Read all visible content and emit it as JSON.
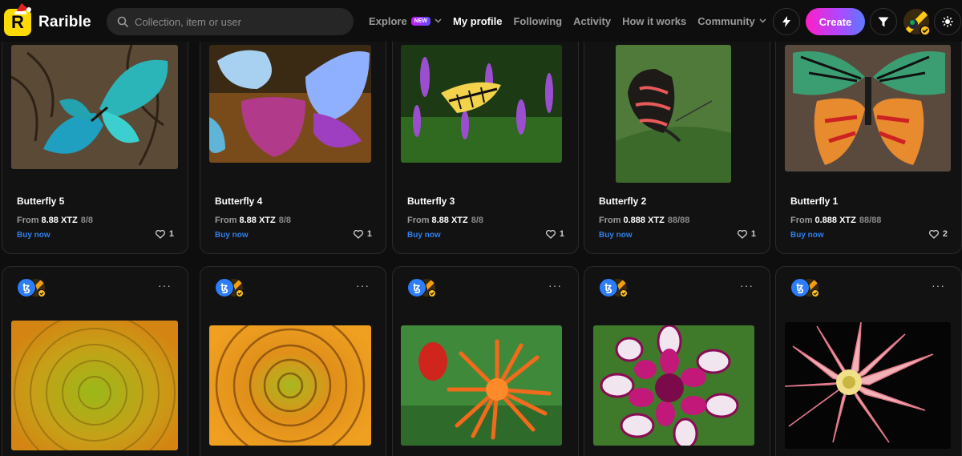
{
  "app": {
    "name": "Rarible"
  },
  "search": {
    "placeholder": "Collection, item or user"
  },
  "nav": {
    "explore": "Explore",
    "explore_badge": "NEW",
    "my_profile": "My profile",
    "following": "Following",
    "activity": "Activity",
    "how_it_works": "How it works",
    "community": "Community"
  },
  "header": {
    "create_label": "Create"
  },
  "colors": {
    "accent_yellow": "#feda03",
    "link_blue": "#2f80ed",
    "create_gradient_start": "#ff1ec8",
    "create_gradient_end": "#5b7bff"
  },
  "icons": [
    "search-icon",
    "lightning-icon",
    "filter-icon",
    "sun-icon",
    "heart-icon",
    "tezos-icon",
    "more-dots-icon",
    "chevron-down-icon",
    "verified-check-icon"
  ],
  "cards_row1": [
    {
      "title": "Butterfly 5",
      "price_prefix": "From",
      "price": "8.88 XTZ",
      "quantity": "8/8",
      "buy": "Buy now",
      "likes": "1"
    },
    {
      "title": "Butterfly 4",
      "price_prefix": "From",
      "price": "8.88 XTZ",
      "quantity": "8/8",
      "buy": "Buy now",
      "likes": "1"
    },
    {
      "title": "Butterfly 3",
      "price_prefix": "From",
      "price": "8.88 XTZ",
      "quantity": "8/8",
      "buy": "Buy now",
      "likes": "1"
    },
    {
      "title": "Butterfly 2",
      "price_prefix": "From",
      "price": "0.888 XTZ",
      "quantity": "88/88",
      "buy": "Buy now",
      "likes": "1"
    },
    {
      "title": "Butterfly 1",
      "price_prefix": "From",
      "price": "0.888 XTZ",
      "quantity": "88/88",
      "buy": "Buy now",
      "likes": "2"
    }
  ],
  "cards_row2": [
    {
      "more": "···",
      "tezos_symbol": "ꜩ"
    },
    {
      "more": "···",
      "tezos_symbol": "ꜩ"
    },
    {
      "more": "···",
      "tezos_symbol": "ꜩ"
    },
    {
      "more": "···",
      "tezos_symbol": "ꜩ"
    },
    {
      "more": "···",
      "tezos_symbol": "ꜩ"
    }
  ]
}
